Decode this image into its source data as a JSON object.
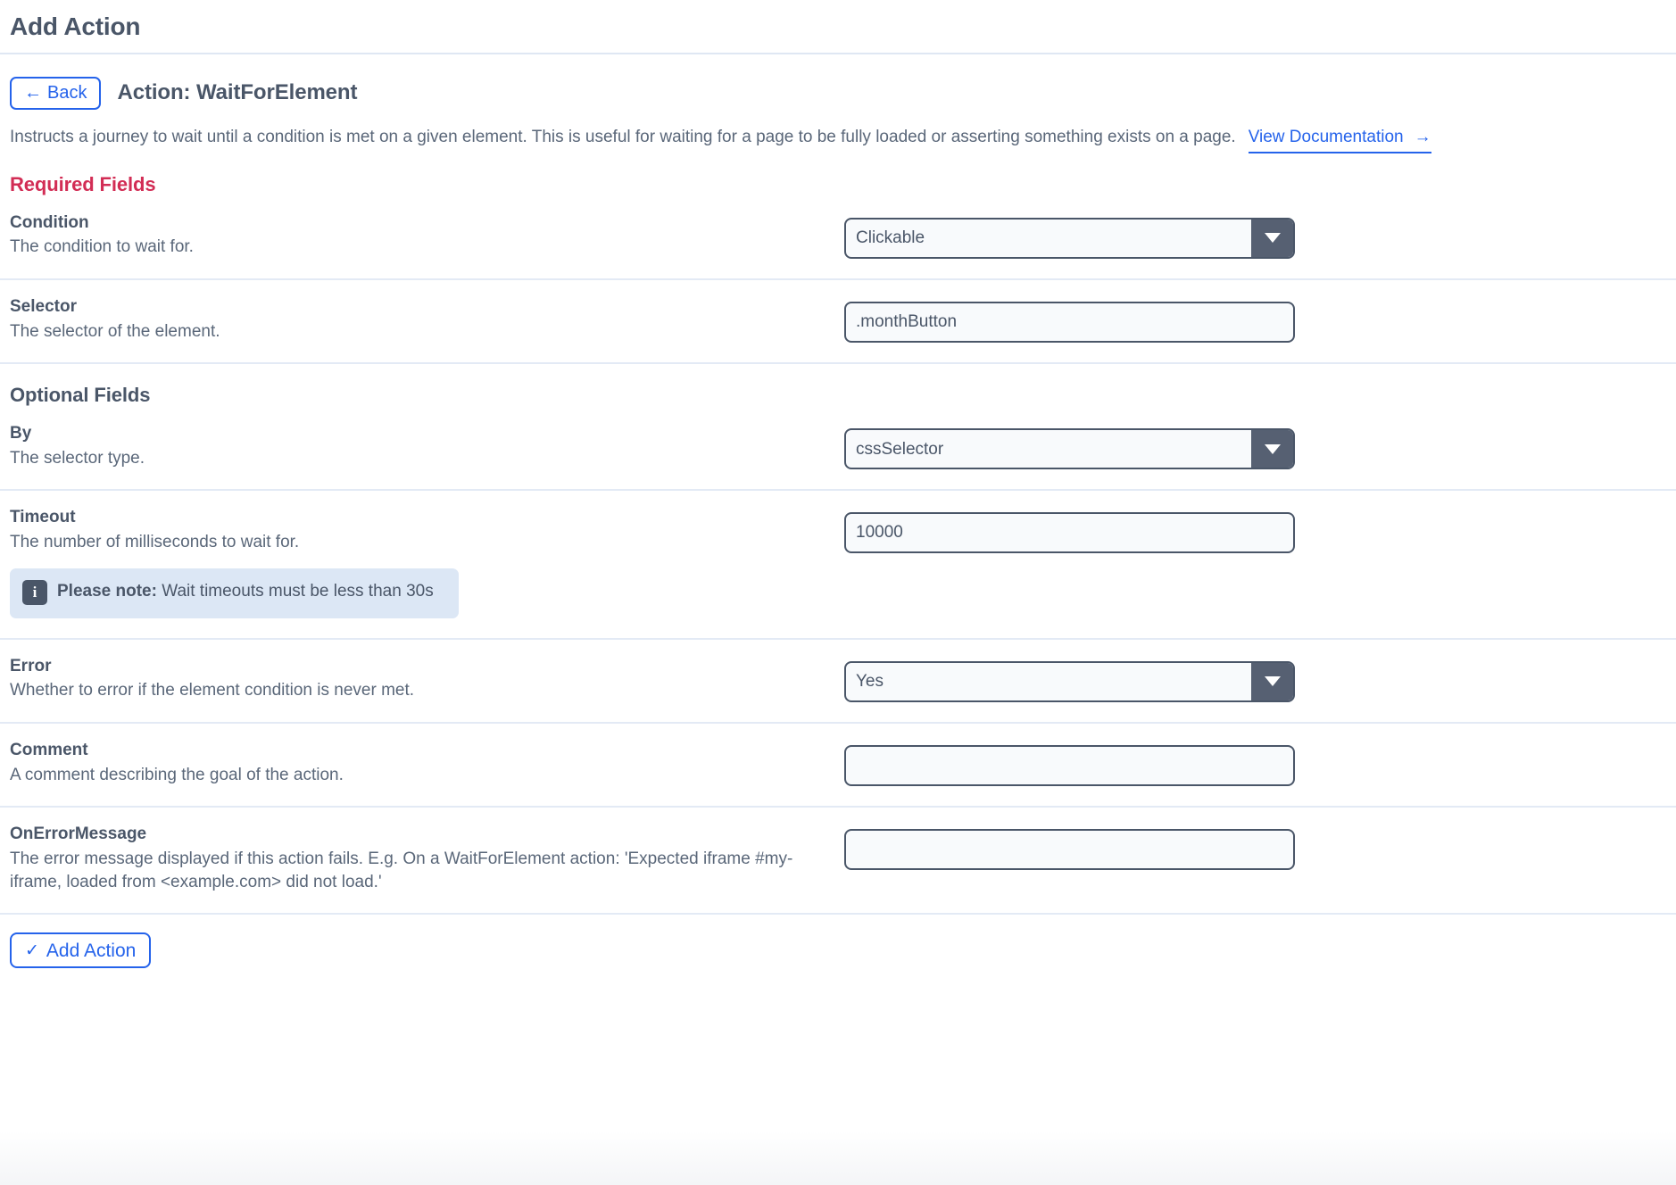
{
  "page": {
    "title": "Add Action"
  },
  "action_header": {
    "back_label": "Back",
    "back_arrow": "←",
    "title": "Action: WaitForElement",
    "description": "Instructs a journey to wait until a condition is met on a given element. This is useful for waiting for a page to be fully loaded or asserting something exists on a page.",
    "doc_link_label": "View Documentation",
    "doc_link_arrow": "→"
  },
  "sections": {
    "required_label": "Required Fields",
    "optional_label": "Optional Fields"
  },
  "fields": {
    "condition": {
      "label": "Condition",
      "description": "The condition to wait for.",
      "value": "Clickable",
      "control": "select"
    },
    "selector": {
      "label": "Selector",
      "description": "The selector of the element.",
      "value": ".monthButton",
      "placeholder": "",
      "control": "text"
    },
    "by": {
      "label": "By",
      "description": "The selector type.",
      "value": "cssSelector",
      "control": "select"
    },
    "timeout": {
      "label": "Timeout",
      "description": "The number of milliseconds to wait for.",
      "value": "10000",
      "placeholder": "",
      "control": "text",
      "note_icon": "i",
      "note_bold": "Please note:",
      "note_text": " Wait timeouts must be less than 30s"
    },
    "error": {
      "label": "Error",
      "description": "Whether to error if the element condition is never met.",
      "value": "Yes",
      "control": "select"
    },
    "comment": {
      "label": "Comment",
      "description": "A comment describing the goal of the action.",
      "value": "",
      "placeholder": "",
      "control": "text"
    },
    "on_error_message": {
      "label": "OnErrorMessage",
      "description": "The error message displayed if this action fails. E.g. On a WaitForElement action: 'Expected iframe #my-iframe, loaded from <example.com> did not load.'",
      "value": "",
      "placeholder": "",
      "control": "text"
    }
  },
  "footer": {
    "add_action_label": "Add Action",
    "check_icon": "✓"
  },
  "colors": {
    "required_heading": "#d22d55",
    "link_blue": "#2563eb",
    "text_slate": "#4a5668",
    "note_bg": "#dce7f5",
    "select_button": "#566072"
  }
}
